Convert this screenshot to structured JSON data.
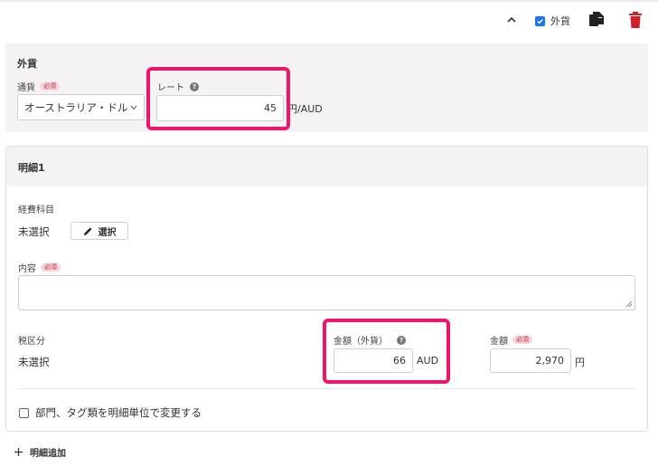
{
  "toolbar": {
    "collapse_icon": "chevron-up-icon",
    "foreign_currency_label": "外貨",
    "foreign_currency_checked": true,
    "copy_icon": "copy-icon",
    "delete_icon": "trash-icon",
    "delete_color": "#d11f2c"
  },
  "fx": {
    "title": "外貨",
    "currency_label": "通貨",
    "required_badge": "必須",
    "currency_value": "オーストラリア・ドル",
    "rate_label": "レート",
    "rate_value": "45",
    "rate_unit": "円/AUD"
  },
  "detail": {
    "title": "明細1",
    "account_label": "経費科目",
    "account_value": "未選択",
    "select_button": "選択",
    "content_label": "内容",
    "required_badge": "必須",
    "tax_label": "税区分",
    "tax_value": "未選択",
    "fx_amount_label": "金額（外貨）",
    "fx_amount_value": "66",
    "fx_amount_unit": "AUD",
    "amount_label": "金額",
    "amount_value": "2,970",
    "amount_unit": "円",
    "dept_checkbox_label": "部門、タグ類を明細単位で変更する"
  },
  "footer": {
    "add_line_label": "明細追加"
  },
  "colors": {
    "highlight": "#f0156b",
    "accent": "#1a73e8",
    "panel_bg": "#f4f2f2"
  }
}
